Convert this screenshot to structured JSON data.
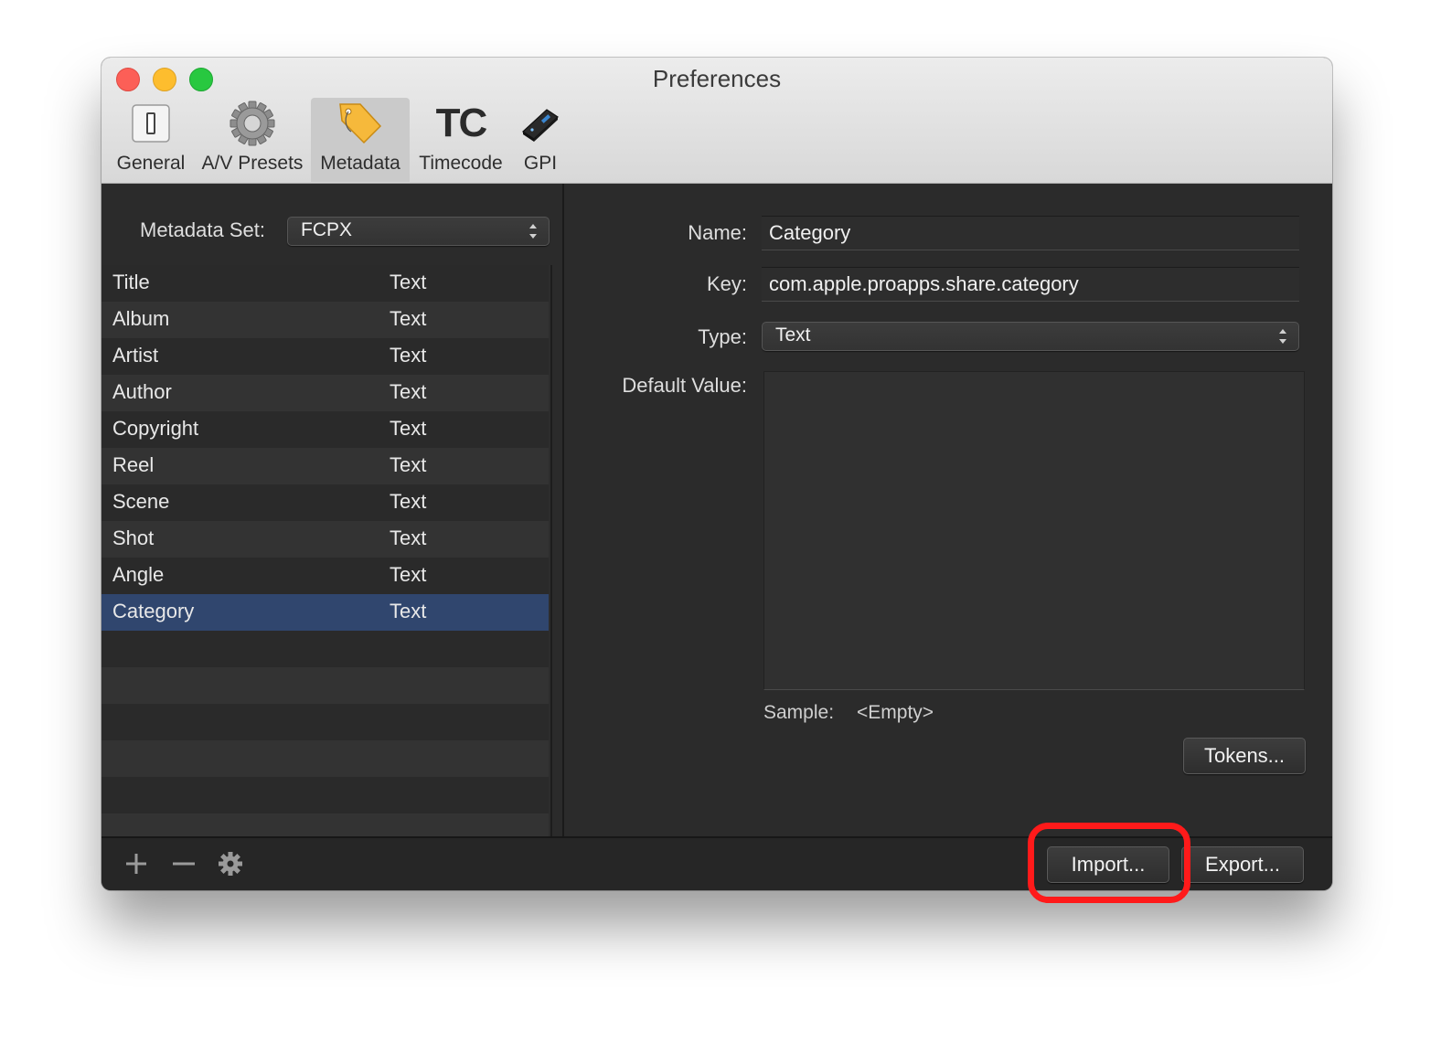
{
  "window": {
    "title": "Preferences"
  },
  "toolbar": {
    "items": [
      {
        "label": "General",
        "icon": "general-icon"
      },
      {
        "label": "A/V Presets",
        "icon": "gear-icon"
      },
      {
        "label": "Metadata",
        "icon": "tag-icon",
        "selected": true
      },
      {
        "label": "Timecode",
        "icon": "timecode-icon",
        "glyph": "TC"
      },
      {
        "label": "GPI",
        "icon": "gpi-device-icon"
      }
    ]
  },
  "metadata_set": {
    "label": "Metadata Set:",
    "value": "FCPX"
  },
  "fields_list": {
    "rows": [
      {
        "name": "Title",
        "type": "Text"
      },
      {
        "name": "Album",
        "type": "Text"
      },
      {
        "name": "Artist",
        "type": "Text"
      },
      {
        "name": "Author",
        "type": "Text"
      },
      {
        "name": "Copyright",
        "type": "Text"
      },
      {
        "name": "Reel",
        "type": "Text"
      },
      {
        "name": "Scene",
        "type": "Text"
      },
      {
        "name": "Shot",
        "type": "Text"
      },
      {
        "name": "Angle",
        "type": "Text"
      },
      {
        "name": "Category",
        "type": "Text",
        "selected": true
      }
    ]
  },
  "detail": {
    "name_label": "Name:",
    "name_value": "Category",
    "key_label": "Key:",
    "key_value": "com.apple.proapps.share.category",
    "type_label": "Type:",
    "type_value": "Text",
    "default_label": "Default Value:",
    "default_value": "",
    "sample_label": "Sample:",
    "sample_value": "<Empty>",
    "tokens_button": "Tokens..."
  },
  "bottom": {
    "import_button": "Import...",
    "export_button": "Export...",
    "add_icon": "plus-icon",
    "remove_icon": "minus-icon",
    "action_icon": "gear-icon"
  },
  "colors": {
    "selection": "#30466e",
    "highlight_annotation": "#ff1a1a"
  }
}
